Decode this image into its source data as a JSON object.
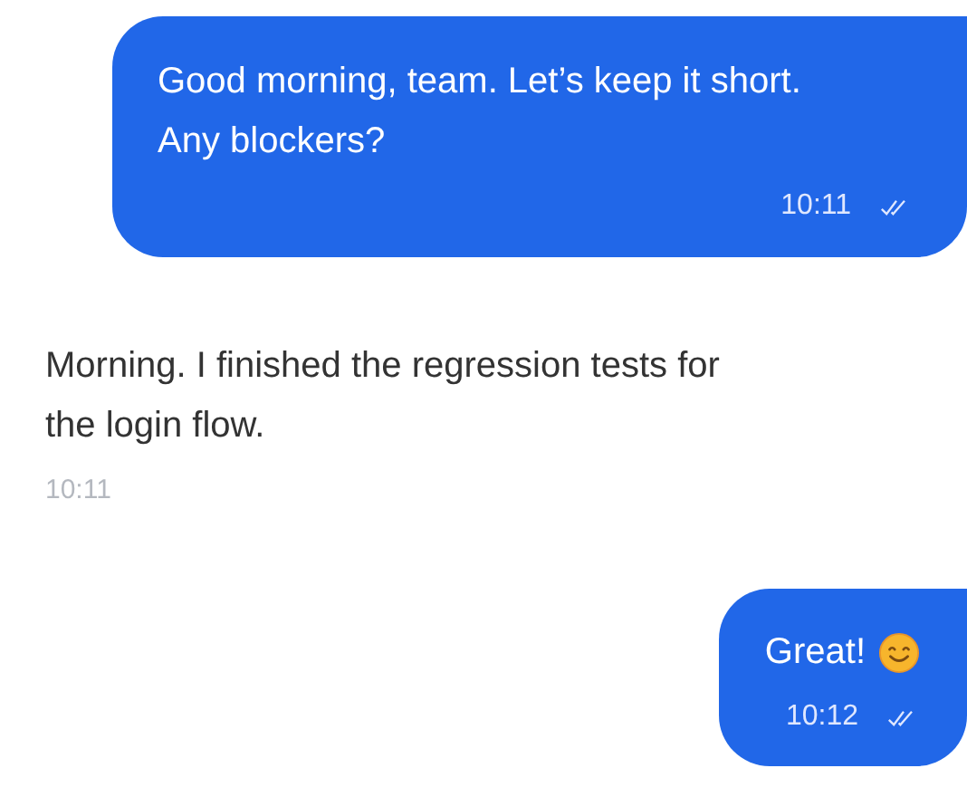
{
  "messages": [
    {
      "kind": "outgoing",
      "text": "Good morning, team. Let’s keep it short. Any blockers?",
      "time": "10:11"
    },
    {
      "kind": "incoming",
      "text": "Morning. I finished the regression tests for the login flow.",
      "time": "10:11"
    },
    {
      "kind": "outgoing",
      "text": "Great!",
      "time": "10:12",
      "emoji": true
    }
  ]
}
